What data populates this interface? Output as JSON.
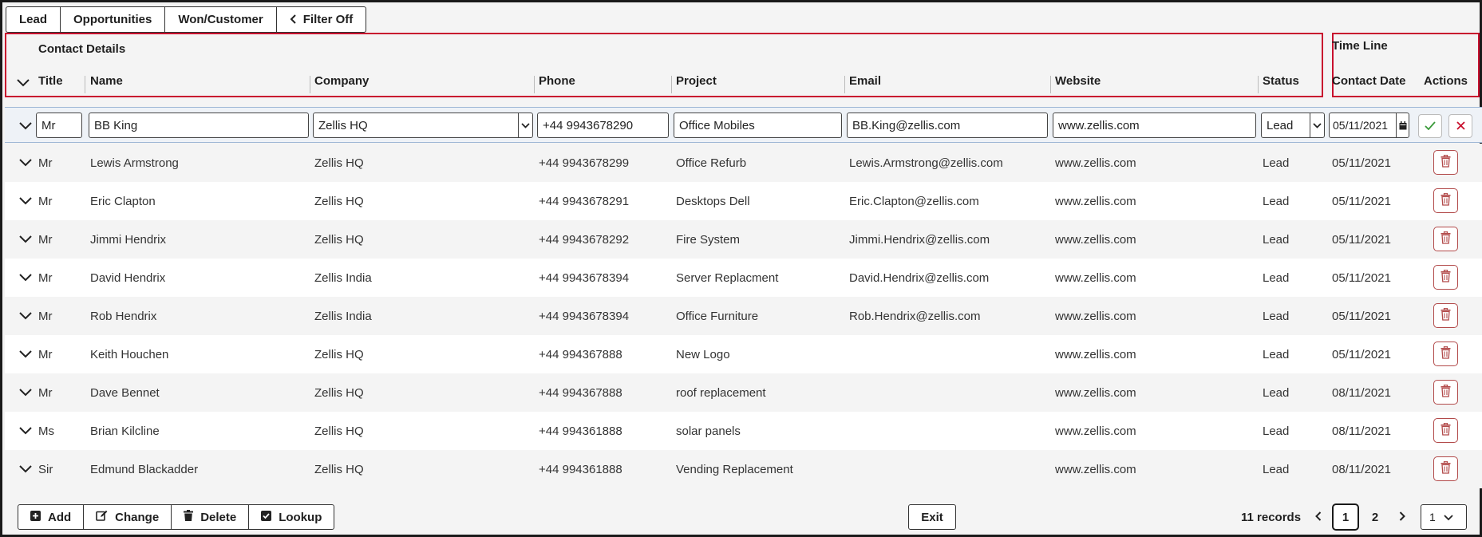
{
  "tabs": [
    {
      "label": "Lead"
    },
    {
      "label": "Opportunities"
    },
    {
      "label": "Won/Customer"
    },
    {
      "label": "Filter Off"
    }
  ],
  "header": {
    "group_contact": "Contact Details",
    "group_timeline": "Time Line",
    "columns": {
      "title": "Title",
      "name": "Name",
      "company": "Company",
      "phone": "Phone",
      "project": "Project",
      "email": "Email",
      "website": "Website",
      "status": "Status",
      "contact_date": "Contact Date",
      "actions": "Actions"
    }
  },
  "edit_row": {
    "title": "Mr",
    "name": "BB King",
    "company": "Zellis HQ",
    "phone": "+44 9943678290",
    "project": "Office Mobiles",
    "email": "BB.King@zellis.com",
    "website": "www.zellis.com",
    "status": "Lead",
    "contact_date": "05/11/2021"
  },
  "rows": [
    {
      "title": "Mr",
      "name": "Lewis Armstrong",
      "company": "Zellis HQ",
      "phone": "+44 9943678299",
      "project": "Office Refurb",
      "email": "Lewis.Armstrong@zellis.com",
      "website": "www.zellis.com",
      "status": "Lead",
      "date": "05/11/2021"
    },
    {
      "title": "Mr",
      "name": "Eric Clapton",
      "company": "Zellis HQ",
      "phone": "+44 9943678291",
      "project": "Desktops Dell",
      "email": "Eric.Clapton@zellis.com",
      "website": "www.zellis.com",
      "status": "Lead",
      "date": "05/11/2021"
    },
    {
      "title": "Mr",
      "name": "Jimmi Hendrix",
      "company": "Zellis HQ",
      "phone": "+44 9943678292",
      "project": "Fire System",
      "email": "Jimmi.Hendrix@zellis.com",
      "website": "www.zellis.com",
      "status": "Lead",
      "date": "05/11/2021"
    },
    {
      "title": "Mr",
      "name": "David Hendrix",
      "company": "Zellis India",
      "phone": "+44 9943678394",
      "project": "Server Replacment",
      "email": "David.Hendrix@zellis.com",
      "website": "www.zellis.com",
      "status": "Lead",
      "date": "05/11/2021"
    },
    {
      "title": "Mr",
      "name": "Rob Hendrix",
      "company": "Zellis India",
      "phone": "+44 9943678394",
      "project": "Office Furniture",
      "email": "Rob.Hendrix@zellis.com",
      "website": "www.zellis.com",
      "status": "Lead",
      "date": "05/11/2021"
    },
    {
      "title": "Mr",
      "name": "Keith Houchen",
      "company": "Zellis HQ",
      "phone": "+44 994367888",
      "project": "New Logo",
      "email": "",
      "website": "www.zellis.com",
      "status": "Lead",
      "date": "05/11/2021"
    },
    {
      "title": "Mr",
      "name": "Dave Bennet",
      "company": "Zellis HQ",
      "phone": "+44 994367888",
      "project": "roof replacement",
      "email": "",
      "website": "www.zellis.com",
      "status": "Lead",
      "date": "08/11/2021"
    },
    {
      "title": "Ms",
      "name": "Brian Kilcline",
      "company": "Zellis HQ",
      "phone": "+44 994361888",
      "project": "solar panels",
      "email": "",
      "website": "www.zellis.com",
      "status": "Lead",
      "date": "08/11/2021"
    },
    {
      "title": "Sir",
      "name": "Edmund Blackadder",
      "company": "Zellis HQ",
      "phone": "+44 994361888",
      "project": "Vending Replacement",
      "email": "",
      "website": "www.zellis.com",
      "status": "Lead",
      "date": "08/11/2021"
    }
  ],
  "footer": {
    "add": "Add",
    "change": "Change",
    "delete": "Delete",
    "lookup": "Lookup",
    "exit": "Exit",
    "records": "11 records",
    "pages": [
      "1",
      "2"
    ],
    "page_size": "1"
  },
  "colors": {
    "highlight_border": "#c8102e",
    "delete_icon": "#b24a4a",
    "confirm_icon": "#3a9a3a",
    "cancel_icon": "#c8102e"
  },
  "icons": {
    "row_expand": "chevron-down-icon",
    "delete": "trash-icon",
    "confirm": "check-icon",
    "cancel": "close-icon",
    "calendar": "calendar-icon"
  }
}
